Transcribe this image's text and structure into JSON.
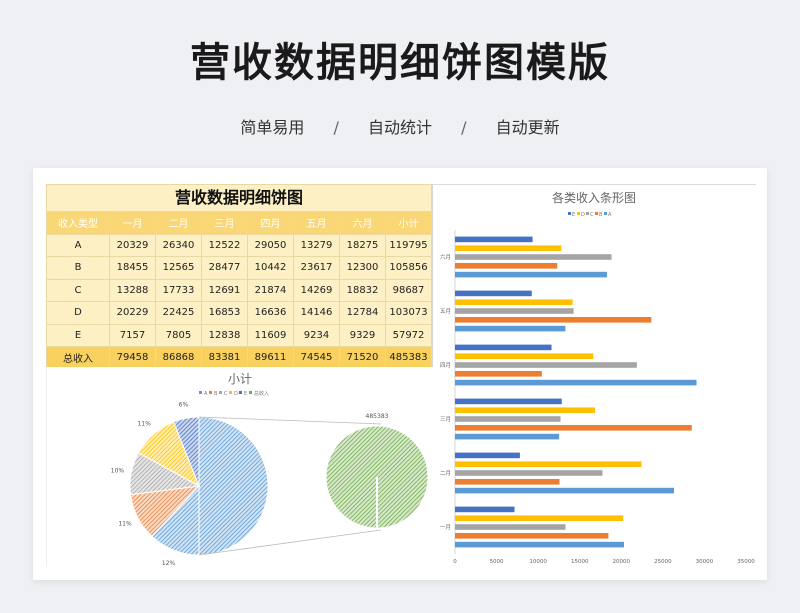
{
  "header": {
    "title": "营收数据明细饼图模版",
    "features": [
      "简单易用",
      "自动统计",
      "自动更新"
    ],
    "separator": "/"
  },
  "table": {
    "title": "营收数据明细饼图",
    "columns": [
      "收入类型",
      "一月",
      "二月",
      "三月",
      "四月",
      "五月",
      "六月",
      "小计"
    ],
    "rows": [
      [
        "A",
        "20329",
        "26340",
        "12522",
        "29050",
        "13279",
        "18275",
        "119795"
      ],
      [
        "B",
        "18455",
        "12565",
        "28477",
        "10442",
        "23617",
        "12300",
        "105856"
      ],
      [
        "C",
        "13288",
        "17733",
        "12691",
        "21874",
        "14269",
        "18832",
        "98687"
      ],
      [
        "D",
        "20229",
        "22425",
        "16853",
        "16636",
        "14146",
        "12784",
        "103073"
      ],
      [
        "E",
        "7157",
        "7805",
        "12838",
        "11609",
        "9234",
        "9329",
        "57972"
      ]
    ],
    "total": [
      "总收入",
      "79458",
      "86868",
      "83381",
      "89611",
      "74545",
      "71520",
      "485383"
    ]
  },
  "colors": {
    "A": "#5b9bd5",
    "B": "#ed7d31",
    "C": "#a5a5a5",
    "D": "#ffc000",
    "E": "#4472c4",
    "total": "#70ad47"
  },
  "chart_data": [
    {
      "type": "pie",
      "title": "小计",
      "legend": [
        "A",
        "B",
        "C",
        "D",
        "E",
        "总收入"
      ],
      "legend_position": "top",
      "slices": [
        {
          "label": "A",
          "value": 119795,
          "pct_label": ""
        },
        {
          "label": "B",
          "value": 105856,
          "pct_label": "12%"
        },
        {
          "label": "C",
          "value": 98687,
          "pct_label": "11%"
        },
        {
          "label": "D",
          "value": 103073,
          "pct_label": "10%"
        },
        {
          "label": "E",
          "value": 57972,
          "pct_label": "11%"
        },
        {
          "label": "总收入",
          "value": 485383,
          "pct_label": "6%"
        }
      ],
      "secondary": {
        "label": "总收入",
        "value": 485383,
        "value_label": "485383"
      }
    },
    {
      "type": "bar",
      "orientation": "horizontal",
      "title": "各类收入条形图",
      "legend": [
        "E",
        "D",
        "C",
        "B",
        "A"
      ],
      "legend_position": "top",
      "categories": [
        "一月",
        "二月",
        "三月",
        "四月",
        "五月",
        "六月"
      ],
      "series": [
        {
          "name": "E",
          "values": [
            7157,
            7805,
            12838,
            11609,
            9234,
            9329
          ]
        },
        {
          "name": "D",
          "values": [
            20229,
            22425,
            16853,
            16636,
            14146,
            12784
          ]
        },
        {
          "name": "C",
          "values": [
            13288,
            17733,
            12691,
            21874,
            14269,
            18832
          ]
        },
        {
          "name": "B",
          "values": [
            18455,
            12565,
            28477,
            10442,
            23617,
            12300
          ]
        },
        {
          "name": "A",
          "values": [
            20329,
            26340,
            12522,
            29050,
            13279,
            18275
          ]
        }
      ],
      "xlim": [
        0,
        35000
      ],
      "xticks": [
        0,
        5000,
        10000,
        15000,
        20000,
        25000,
        30000,
        35000
      ],
      "grid": false
    }
  ]
}
